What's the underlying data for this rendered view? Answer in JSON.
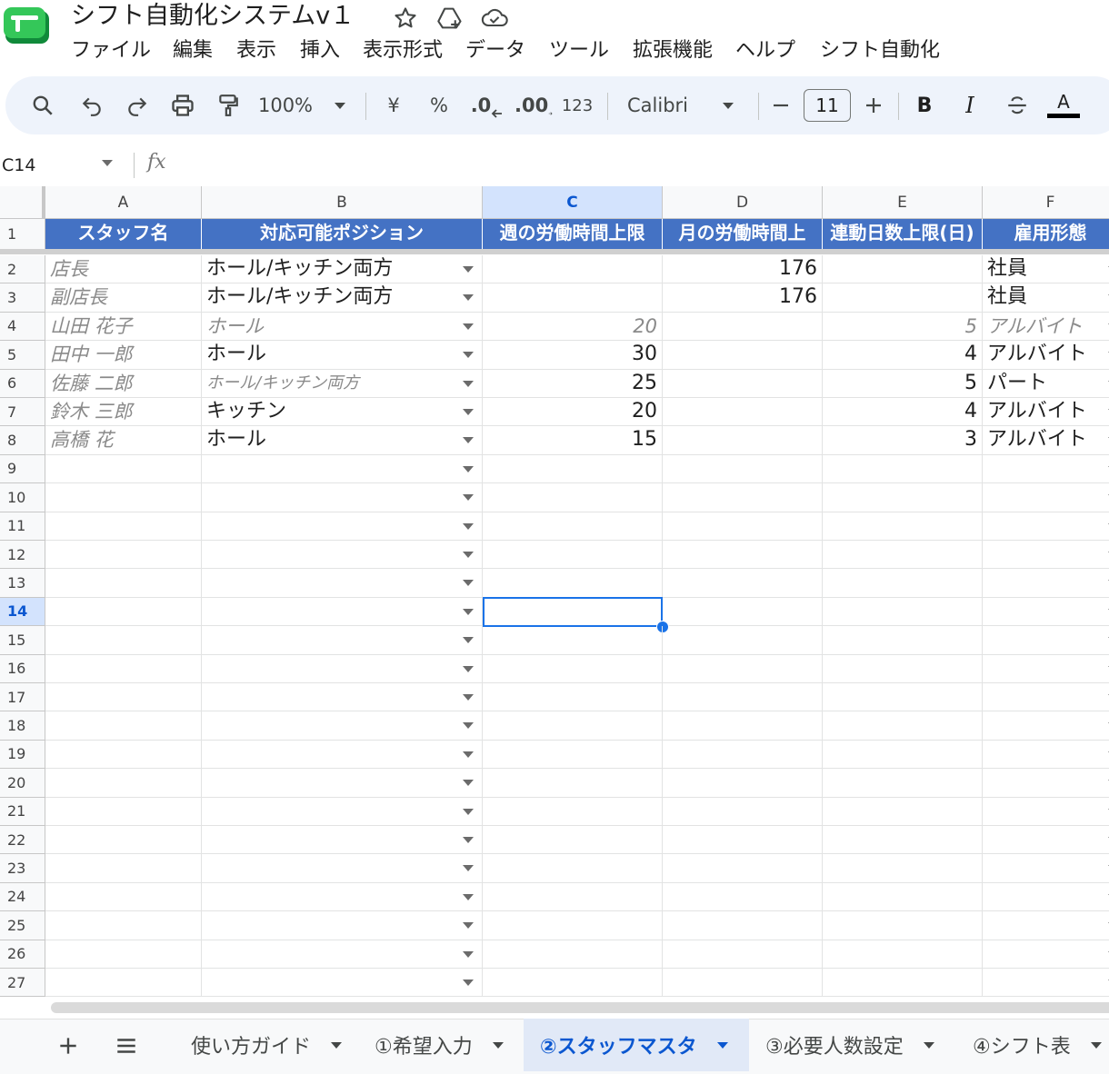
{
  "app": {
    "title": "シフト自動化システムv１",
    "menu": [
      "ファイル",
      "編集",
      "表示",
      "挿入",
      "表示形式",
      "データ",
      "ツール",
      "拡張機能",
      "ヘルプ",
      "シフト自動化"
    ]
  },
  "toolbar": {
    "zoom": "100%",
    "currency": "¥",
    "percent": "%",
    "decrease_decimal": ".0",
    "increase_decimal": ".00",
    "number_format": "123",
    "font": "Calibri",
    "font_size": "11",
    "bold": "B",
    "italic": "I",
    "text_color": "A"
  },
  "formula_bar": {
    "name_box": "C14",
    "fx": "fx",
    "value": ""
  },
  "grid": {
    "columns": [
      "A",
      "B",
      "C",
      "D",
      "E",
      "F"
    ],
    "selected_column": "C",
    "selected_row": "14",
    "header_row": [
      "スタッフ名",
      "対応可能ポジション",
      "週の労働時間上限",
      "月の労働時間上",
      "連動日数上限(日)",
      "雇用形態"
    ],
    "rows": [
      {
        "n": "2",
        "a": "店長",
        "b": "ホール/キッチン両方",
        "c": "",
        "d": "176",
        "e": "",
        "f": "社員"
      },
      {
        "n": "3",
        "a": "副店長",
        "b": "ホール/キッチン両方",
        "c": "",
        "d": "176",
        "e": "",
        "f": "社員"
      },
      {
        "n": "4",
        "a": "山田 花子",
        "b": "ホール",
        "c": "20",
        "d": "",
        "e": "5",
        "f": "アルバイト"
      },
      {
        "n": "5",
        "a": "田中 一郎",
        "b": "ホール",
        "c": "30",
        "d": "",
        "e": "4",
        "f": "アルバイト"
      },
      {
        "n": "6",
        "a": "佐藤 二郎",
        "b": "ホール/キッチン両方",
        "c": "25",
        "d": "",
        "e": "5",
        "f": "パート"
      },
      {
        "n": "7",
        "a": "鈴木 三郎",
        "b": "キッチン",
        "c": "20",
        "d": "",
        "e": "4",
        "f": "アルバイト"
      },
      {
        "n": "8",
        "a": "高橋 花",
        "b": "ホール",
        "c": "15",
        "d": "",
        "e": "3",
        "f": "アルバイト"
      }
    ],
    "empty_rows": [
      "9",
      "10",
      "11",
      "12",
      "13",
      "14",
      "15",
      "16",
      "17",
      "18",
      "19",
      "20",
      "21",
      "22",
      "23",
      "24",
      "25",
      "26",
      "27"
    ]
  },
  "sheets": {
    "tabs": [
      "使い方ガイド",
      "①希望入力",
      "②スタッフマスタ",
      "③必要人数設定",
      "④シフト表"
    ],
    "active": "②スタッフマスタ"
  },
  "colors": {
    "header_fill": "#4472c4",
    "accent": "#0b57d0",
    "selection": "#1a73e8"
  }
}
